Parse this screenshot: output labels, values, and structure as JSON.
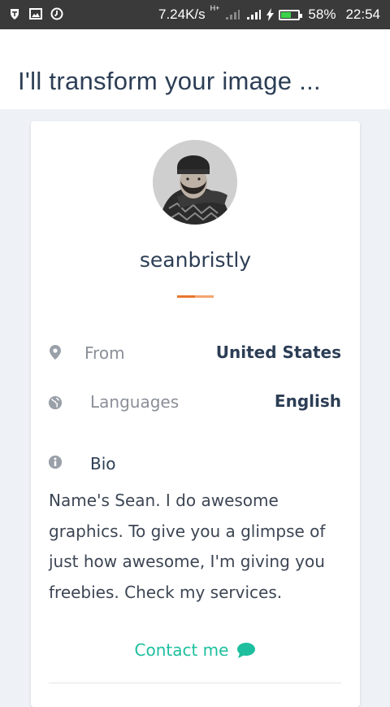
{
  "status_bar": {
    "speed": "7.24K/s",
    "network": "H+",
    "battery": "58%",
    "time": "22:54",
    "icons": [
      "shield-icon",
      "image-icon",
      "clock-icon",
      "signal-icon",
      "signal-icon",
      "charging-icon",
      "battery-icon"
    ]
  },
  "header": {
    "title": "I'll transform your image ..."
  },
  "profile": {
    "username": "seanbristly",
    "from_label": "From",
    "from_value": "United States",
    "languages_label": "Languages",
    "languages_value": "English",
    "bio_label": "Bio",
    "bio_text": "Name's Sean. I do awesome graphics. To give you a glimpse of just how awesome, I'm giving you freebies. Check my services.",
    "contact_label": "Contact me",
    "icons": [
      "location-pin-icon",
      "globe-icon",
      "info-icon",
      "chat-icon"
    ]
  },
  "colors": {
    "accent": "#1dbf9e",
    "title_text": "#2c3e55",
    "underline_orange": "#e8772e",
    "underline_light": "#f3a46f",
    "battery_green": "#3bd34a"
  }
}
